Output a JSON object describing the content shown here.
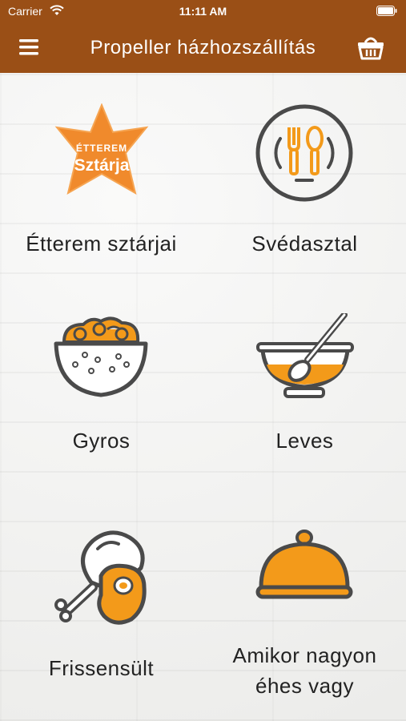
{
  "status_bar": {
    "carrier": "Carrier",
    "time": "11:11 AM"
  },
  "nav": {
    "title": "Propeller házhozszállítás"
  },
  "tiles": [
    {
      "label": "Étterem sztárjai",
      "badge_line1": "ÉTTEREM",
      "badge_line2": "Sztárja"
    },
    {
      "label": "Svédasztal"
    },
    {
      "label": "Gyros"
    },
    {
      "label": "Leves"
    },
    {
      "label": "Frissensült"
    },
    {
      "label": "Amikor nagyon éhes vagy"
    }
  ],
  "colors": {
    "header": "#9a4f16",
    "accent_orange": "#f39a1a",
    "icon_gray": "#4a4a4a",
    "star_orange": "#f08a2c"
  },
  "icons": [
    "hamburger-menu-icon",
    "basket-icon",
    "star-badge-icon",
    "plate-cutlery-icon",
    "rice-bowl-icon",
    "soup-bowl-spoon-icon",
    "chicken-leg-steak-icon",
    "cloche-icon"
  ]
}
